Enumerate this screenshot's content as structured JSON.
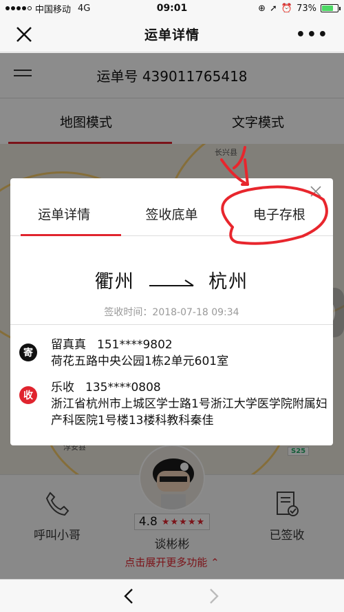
{
  "status_bar": {
    "carrier": "中国移动",
    "network": "4G",
    "time": "09:01",
    "battery": "73%",
    "battery_level": 0.73
  },
  "nav": {
    "title": "运单详情",
    "more": "•••"
  },
  "waybill": {
    "text": "运单号 439011765418"
  },
  "modes": {
    "map": "地图模式",
    "text": "文字模式"
  },
  "map_labels": [
    "长兴县",
    "淳安县",
    "S25"
  ],
  "bottom": {
    "call": "呼叫小哥",
    "signed": "已签收",
    "rating": "4.8",
    "stars": "★★★★★",
    "courier_name": "谈彬彬",
    "expand": "点击展开更多功能"
  },
  "modal": {
    "tabs": [
      "运单详情",
      "签收底单",
      "电子存根"
    ],
    "from": "衢州",
    "to": "杭州",
    "sign_time": "签收时间：2018-07-18 09:34",
    "sender": {
      "badge": "寄",
      "name": "留真真",
      "phone": "151****9802",
      "address": "荷花五路中央公园1栋2单元601室"
    },
    "receiver": {
      "badge": "收",
      "name": "乐收",
      "phone": "135****0808",
      "address": "浙江省杭州市上城区学士路1号浙江大学医学院附属妇产科医院1号楼13楼科教科秦佳"
    }
  },
  "colors": {
    "accent": "#e0242e",
    "annotation": "#e8262d"
  }
}
